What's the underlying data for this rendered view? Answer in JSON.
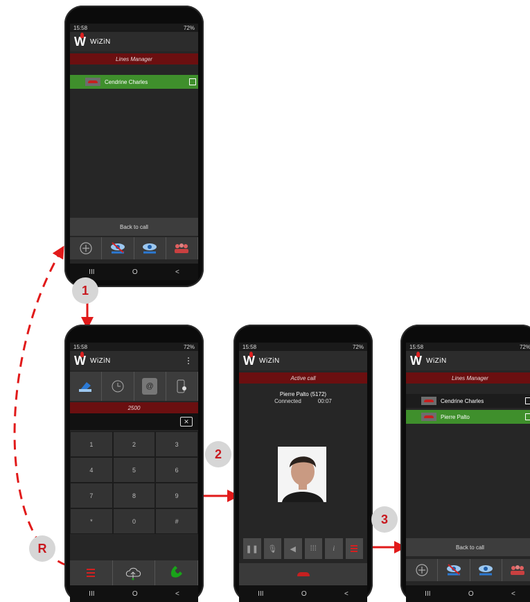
{
  "status_time": "15:58",
  "status_right": "72%",
  "app_name": "WiZiN",
  "colors": {
    "accent_red": "#d42020",
    "bar_red": "#6b0f10",
    "active_green": "#3f8f2c",
    "call_green": "#19a319"
  },
  "screen1": {
    "header": "Lines Manager",
    "lines": [
      {
        "name": "Cendrine Charles",
        "state": "active"
      }
    ],
    "back_to_call": "Back to call",
    "tabs": [
      "add-call-icon",
      "transfer-icon",
      "supervise-icon",
      "conference-icon"
    ]
  },
  "screen2": {
    "tabs": [
      "dialpad-icon",
      "history-icon",
      "contacts-icon",
      "mobile-icon"
    ],
    "dialed_number": "2500",
    "keys": [
      "1",
      "2",
      "3",
      "4",
      "5",
      "6",
      "7",
      "8",
      "9",
      "*",
      "0",
      "#"
    ],
    "bottom": [
      "lines-manager-icon",
      "voicemail-icon",
      "call-icon"
    ]
  },
  "screen3": {
    "header": "Active call",
    "caller": "Pierre Palto (5172)",
    "state": "Connected",
    "duration": "00:07",
    "controls": [
      "pause-icon",
      "mic-icon",
      "speaker-icon",
      "keypad-icon",
      "info-icon",
      "lines-manager-icon"
    ]
  },
  "screen4": {
    "header": "Lines Manager",
    "lines": [
      {
        "name": "Cendrine Charles",
        "state": "held"
      },
      {
        "name": "Pierre Palto",
        "state": "active"
      }
    ],
    "back_to_call": "Back to call"
  },
  "steps": [
    "1",
    "2",
    "3",
    "R"
  ],
  "nav": [
    "III",
    "O",
    "<"
  ]
}
